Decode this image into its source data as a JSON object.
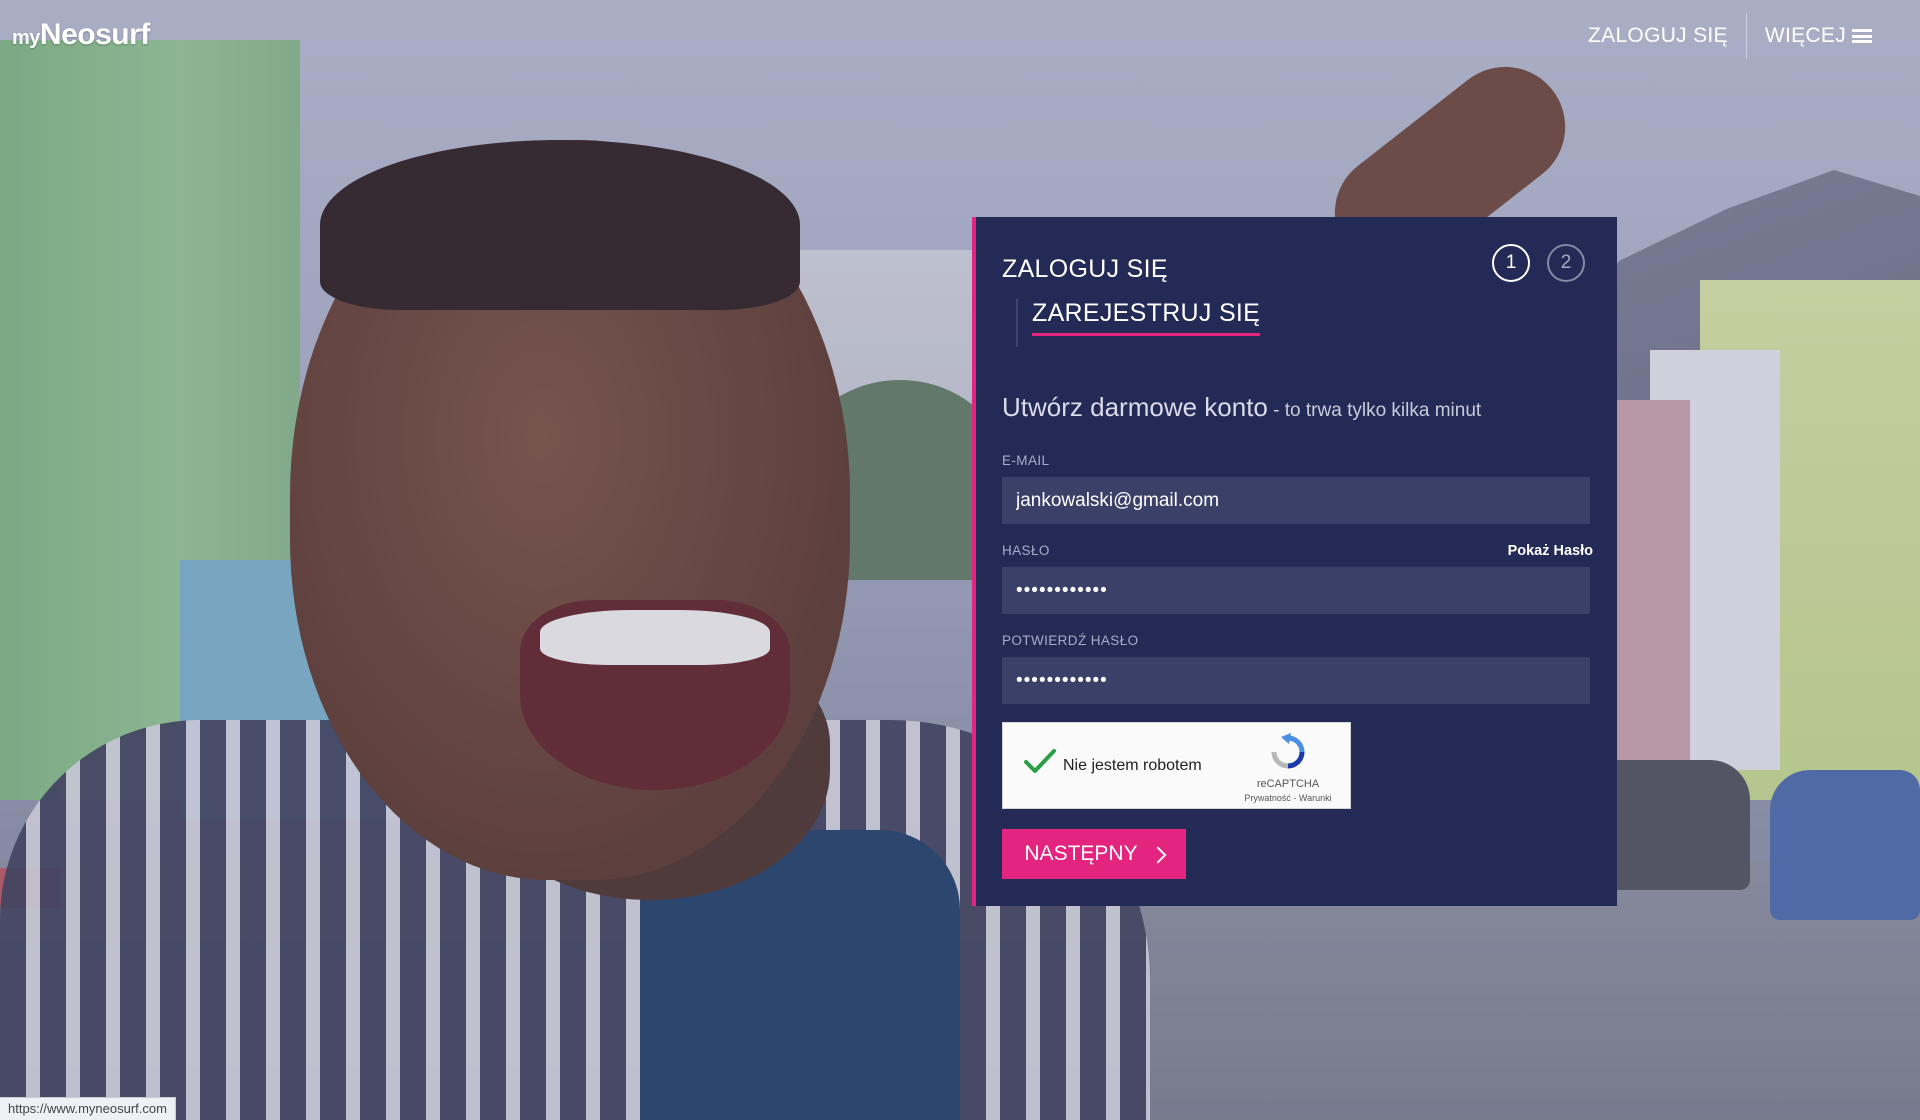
{
  "header": {
    "logo_prefix": "my",
    "logo_name": "Neosurf",
    "nav_login": "ZALOGUJ SIĘ",
    "nav_more": "WIĘCEJ"
  },
  "card": {
    "tab_login": "ZALOGUJ SIĘ",
    "tab_register": "ZAREJESTRUJ SIĘ",
    "steps": [
      "1",
      "2"
    ],
    "active_step": 1,
    "headline": "Utwórz darmowe konto",
    "headline_sub": " - to trwa tylko kilka minut",
    "email": {
      "label": "E-MAIL",
      "value": "jankowalski@gmail.com"
    },
    "password": {
      "label": "HASŁO",
      "value": "••••••••••••",
      "show_label": "Pokaż Hasło"
    },
    "confirm_password": {
      "label": "POTWIERDŹ HASŁO",
      "value": "••••••••••••"
    },
    "captcha": {
      "checked": true,
      "text": "Nie jestem robotem",
      "brand": "reCAPTCHA",
      "links": "Prywatność - Warunki"
    },
    "next_button": "NASTĘPNY"
  },
  "status_url": "https://www.myneosurf.com",
  "colors": {
    "accent": "#e4257f",
    "card_bg": "#232a56",
    "input_bg": "#3a4068"
  }
}
